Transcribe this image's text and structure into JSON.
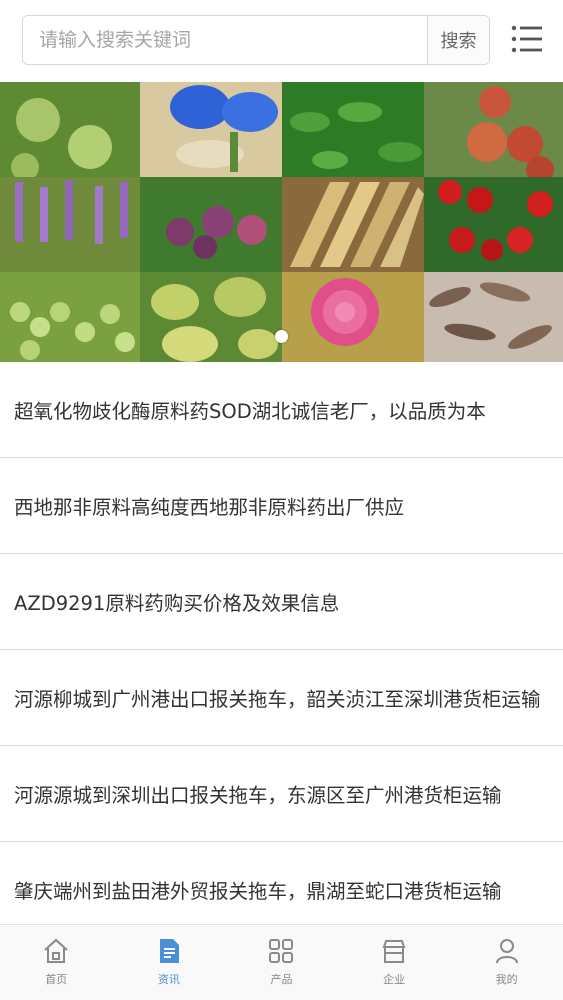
{
  "search": {
    "placeholder": "请输入搜索关键词",
    "button_label": "搜索"
  },
  "banner": {
    "tiles": [
      {
        "name": "green-apples",
        "color": "#6f9a3e"
      },
      {
        "name": "blue-flower",
        "color": "#3a6ed8"
      },
      {
        "name": "green-seedlings",
        "color": "#3c8a2c"
      },
      {
        "name": "red-apricots",
        "color": "#b8553a"
      },
      {
        "name": "purple-flowers",
        "color": "#8a5aa8"
      },
      {
        "name": "plums",
        "color": "#7a3f6a"
      },
      {
        "name": "dried-herbs",
        "color": "#c9a763"
      },
      {
        "name": "cherries",
        "color": "#c41e1e"
      },
      {
        "name": "green-grapes",
        "color": "#9fc05a"
      },
      {
        "name": "figs",
        "color": "#b4c45e"
      },
      {
        "name": "pink-rose",
        "color": "#e0508a"
      },
      {
        "name": "dried-pods",
        "color": "#8a7060"
      }
    ]
  },
  "news": [
    {
      "title": "超氧化物歧化酶原料药SOD湖北诚信老厂，以品质为本"
    },
    {
      "title": "西地那非原料高纯度西地那非原料药出厂供应"
    },
    {
      "title": "AZD9291原料药购买价格及效果信息"
    },
    {
      "title": "河源柳城到广州港出口报关拖车，韶关浈江至深圳港货柜运输"
    },
    {
      "title": "河源源城到深圳出口报关拖车，东源区至广州港货柜运输"
    },
    {
      "title": "肇庆端州到盐田港外贸报关拖车，鼎湖至蛇口港货柜运输"
    }
  ],
  "tabbar": {
    "home": "首页",
    "news": "资讯",
    "products": "产品",
    "company": "企业",
    "mine": "我的"
  },
  "colors": {
    "accent": "#4a8fd8",
    "icon_gray": "#8a8a8a"
  }
}
